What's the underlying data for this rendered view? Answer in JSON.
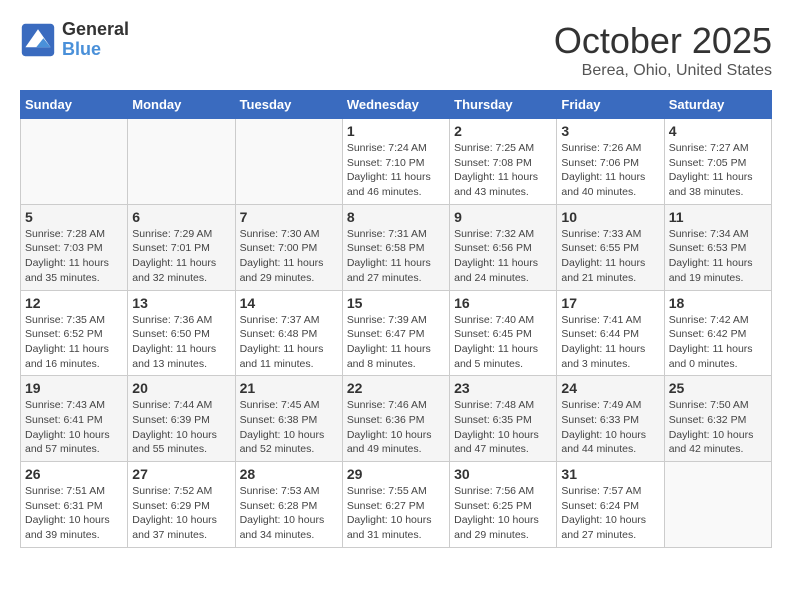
{
  "header": {
    "logo_line1": "General",
    "logo_line2": "Blue",
    "month": "October 2025",
    "location": "Berea, Ohio, United States"
  },
  "days_of_week": [
    "Sunday",
    "Monday",
    "Tuesday",
    "Wednesday",
    "Thursday",
    "Friday",
    "Saturday"
  ],
  "weeks": [
    [
      {
        "day": "",
        "info": ""
      },
      {
        "day": "",
        "info": ""
      },
      {
        "day": "",
        "info": ""
      },
      {
        "day": "1",
        "info": "Sunrise: 7:24 AM\nSunset: 7:10 PM\nDaylight: 11 hours and 46 minutes."
      },
      {
        "day": "2",
        "info": "Sunrise: 7:25 AM\nSunset: 7:08 PM\nDaylight: 11 hours and 43 minutes."
      },
      {
        "day": "3",
        "info": "Sunrise: 7:26 AM\nSunset: 7:06 PM\nDaylight: 11 hours and 40 minutes."
      },
      {
        "day": "4",
        "info": "Sunrise: 7:27 AM\nSunset: 7:05 PM\nDaylight: 11 hours and 38 minutes."
      }
    ],
    [
      {
        "day": "5",
        "info": "Sunrise: 7:28 AM\nSunset: 7:03 PM\nDaylight: 11 hours and 35 minutes."
      },
      {
        "day": "6",
        "info": "Sunrise: 7:29 AM\nSunset: 7:01 PM\nDaylight: 11 hours and 32 minutes."
      },
      {
        "day": "7",
        "info": "Sunrise: 7:30 AM\nSunset: 7:00 PM\nDaylight: 11 hours and 29 minutes."
      },
      {
        "day": "8",
        "info": "Sunrise: 7:31 AM\nSunset: 6:58 PM\nDaylight: 11 hours and 27 minutes."
      },
      {
        "day": "9",
        "info": "Sunrise: 7:32 AM\nSunset: 6:56 PM\nDaylight: 11 hours and 24 minutes."
      },
      {
        "day": "10",
        "info": "Sunrise: 7:33 AM\nSunset: 6:55 PM\nDaylight: 11 hours and 21 minutes."
      },
      {
        "day": "11",
        "info": "Sunrise: 7:34 AM\nSunset: 6:53 PM\nDaylight: 11 hours and 19 minutes."
      }
    ],
    [
      {
        "day": "12",
        "info": "Sunrise: 7:35 AM\nSunset: 6:52 PM\nDaylight: 11 hours and 16 minutes."
      },
      {
        "day": "13",
        "info": "Sunrise: 7:36 AM\nSunset: 6:50 PM\nDaylight: 11 hours and 13 minutes."
      },
      {
        "day": "14",
        "info": "Sunrise: 7:37 AM\nSunset: 6:48 PM\nDaylight: 11 hours and 11 minutes."
      },
      {
        "day": "15",
        "info": "Sunrise: 7:39 AM\nSunset: 6:47 PM\nDaylight: 11 hours and 8 minutes."
      },
      {
        "day": "16",
        "info": "Sunrise: 7:40 AM\nSunset: 6:45 PM\nDaylight: 11 hours and 5 minutes."
      },
      {
        "day": "17",
        "info": "Sunrise: 7:41 AM\nSunset: 6:44 PM\nDaylight: 11 hours and 3 minutes."
      },
      {
        "day": "18",
        "info": "Sunrise: 7:42 AM\nSunset: 6:42 PM\nDaylight: 11 hours and 0 minutes."
      }
    ],
    [
      {
        "day": "19",
        "info": "Sunrise: 7:43 AM\nSunset: 6:41 PM\nDaylight: 10 hours and 57 minutes."
      },
      {
        "day": "20",
        "info": "Sunrise: 7:44 AM\nSunset: 6:39 PM\nDaylight: 10 hours and 55 minutes."
      },
      {
        "day": "21",
        "info": "Sunrise: 7:45 AM\nSunset: 6:38 PM\nDaylight: 10 hours and 52 minutes."
      },
      {
        "day": "22",
        "info": "Sunrise: 7:46 AM\nSunset: 6:36 PM\nDaylight: 10 hours and 49 minutes."
      },
      {
        "day": "23",
        "info": "Sunrise: 7:48 AM\nSunset: 6:35 PM\nDaylight: 10 hours and 47 minutes."
      },
      {
        "day": "24",
        "info": "Sunrise: 7:49 AM\nSunset: 6:33 PM\nDaylight: 10 hours and 44 minutes."
      },
      {
        "day": "25",
        "info": "Sunrise: 7:50 AM\nSunset: 6:32 PM\nDaylight: 10 hours and 42 minutes."
      }
    ],
    [
      {
        "day": "26",
        "info": "Sunrise: 7:51 AM\nSunset: 6:31 PM\nDaylight: 10 hours and 39 minutes."
      },
      {
        "day": "27",
        "info": "Sunrise: 7:52 AM\nSunset: 6:29 PM\nDaylight: 10 hours and 37 minutes."
      },
      {
        "day": "28",
        "info": "Sunrise: 7:53 AM\nSunset: 6:28 PM\nDaylight: 10 hours and 34 minutes."
      },
      {
        "day": "29",
        "info": "Sunrise: 7:55 AM\nSunset: 6:27 PM\nDaylight: 10 hours and 31 minutes."
      },
      {
        "day": "30",
        "info": "Sunrise: 7:56 AM\nSunset: 6:25 PM\nDaylight: 10 hours and 29 minutes."
      },
      {
        "day": "31",
        "info": "Sunrise: 7:57 AM\nSunset: 6:24 PM\nDaylight: 10 hours and 27 minutes."
      },
      {
        "day": "",
        "info": ""
      }
    ]
  ]
}
